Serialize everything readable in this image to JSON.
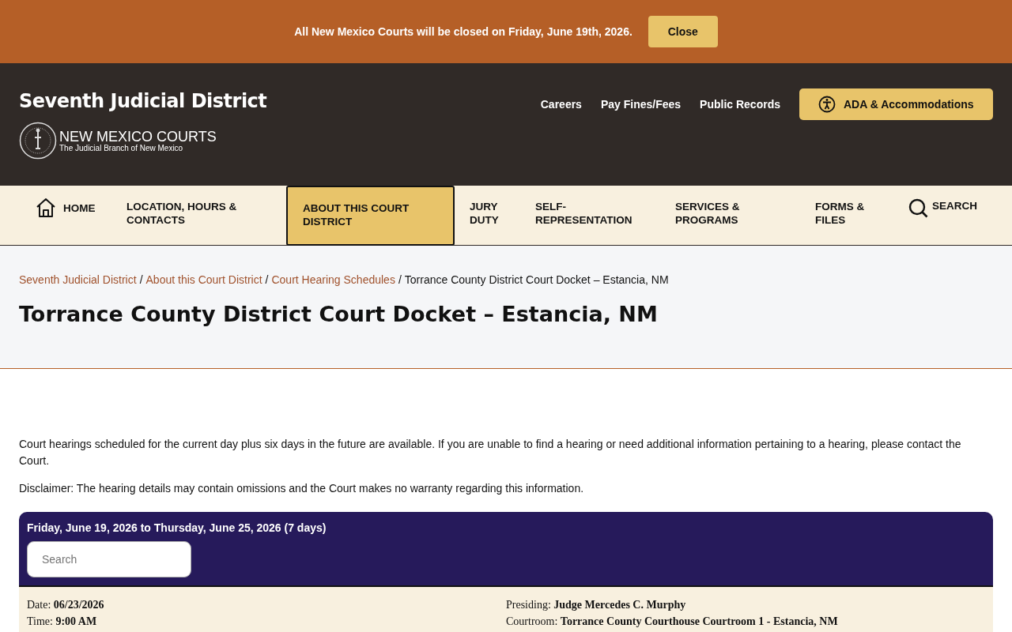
{
  "alert": {
    "message": "All New Mexico Courts will be closed on Friday, June 19th, 2026.",
    "button": "Close"
  },
  "header": {
    "site_title": "Seventh Judicial District",
    "logo_title": "NEW MEXICO COURTS",
    "logo_subtitle": "The Judicial Branch of New Mexico",
    "links": [
      "Careers",
      "Pay Fines/Fees",
      "Public Records"
    ],
    "ada_button": "ADA & Accommodations"
  },
  "nav": {
    "items": [
      {
        "label": "HOME",
        "kind": "home",
        "selected": false
      },
      {
        "label": "LOCATION, HOURS & CONTACTS",
        "kind": "link",
        "selected": false
      },
      {
        "label": "ABOUT THIS COURT DISTRICT",
        "kind": "link",
        "selected": true
      },
      {
        "label": "JURY DUTY",
        "kind": "link",
        "selected": false
      },
      {
        "label": "SELF-REPRESENTATION",
        "kind": "link",
        "selected": false
      },
      {
        "label": "SERVICES & PROGRAMS",
        "kind": "link",
        "selected": false
      },
      {
        "label": "FORMS & FILES",
        "kind": "link",
        "selected": false
      }
    ],
    "search": "SEARCH"
  },
  "breadcrumb": {
    "separator": "/",
    "links": [
      "Seventh Judicial District",
      "About this Court District",
      "Court Hearing Schedules"
    ],
    "current": "Torrance County District Court Docket – Estancia, NM"
  },
  "page_title": "Torrance County District Court Docket – Estancia, NM",
  "intro": "Court hearings scheduled for the current day plus six days in the future are available. If you are unable to find a hearing or need additional information pertaining to a hearing, please contact the Court.",
  "disclaimer": "Disclaimer:  The hearing details may contain omissions and the Court makes no warranty regarding this information.",
  "docket": {
    "range": "Friday, June 19, 2026 to Thursday, June 25, 2026 (7 days)",
    "search": {
      "placeholder": "Search"
    },
    "hearing": {
      "left": [
        {
          "label": "Date:",
          "value": "06/23/2026"
        },
        {
          "label": "Time:",
          "value": "9:00 AM"
        }
      ],
      "right": [
        {
          "label": "Presiding:",
          "value": "Judge Mercedes C. Murphy"
        },
        {
          "label": "Courtroom:",
          "value": "Torrance County Courthouse Courtroom 1 - Estancia, NM"
        }
      ]
    }
  }
}
